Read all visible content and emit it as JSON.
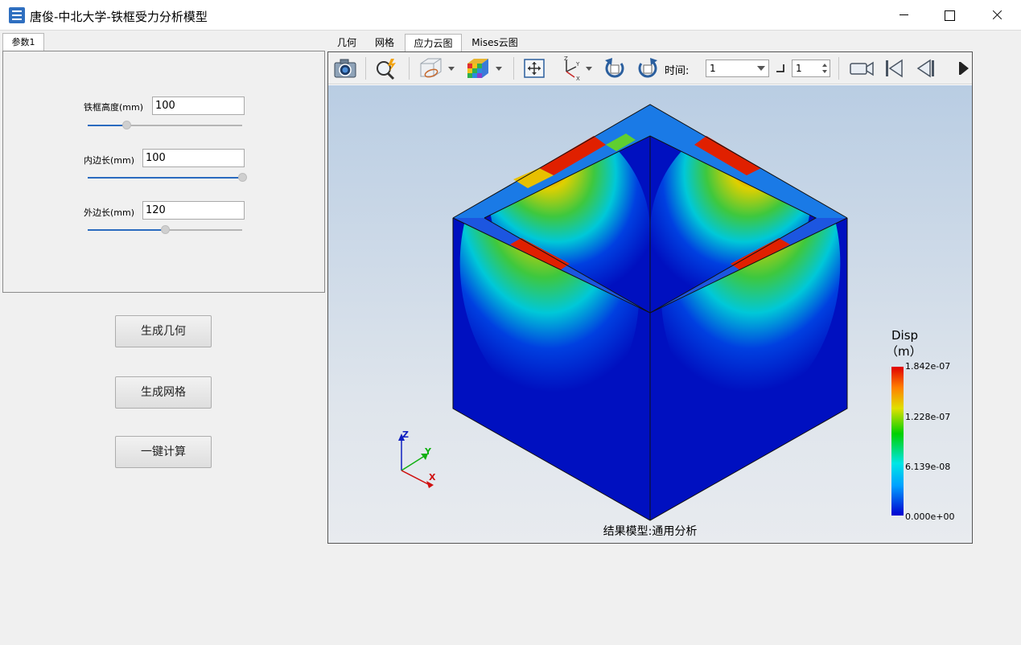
{
  "window": {
    "title": "唐俊-中北大学-铁框受力分析模型"
  },
  "left_panel": {
    "tab": "参数1",
    "params": [
      {
        "label": "铁框高度(mm)",
        "value": "100",
        "slider_fraction": 0.25
      },
      {
        "label": "内边长(mm)",
        "value": "100",
        "slider_fraction": 1.0
      },
      {
        "label": "外边长(mm)",
        "value": "120",
        "slider_fraction": 0.5
      }
    ]
  },
  "actions": {
    "generate_geometry": "生成几何",
    "generate_mesh": "生成网格",
    "compute": "一键计算"
  },
  "view_tabs": [
    "几何",
    "网格",
    "应力云图",
    "Mises云图"
  ],
  "active_view_tab": "应力云图",
  "toolbar": {
    "time_label": "时间:",
    "time_value": "1",
    "step_value": "1",
    "icons": [
      "camera-icon",
      "zoom-icon",
      "view-mode-icon",
      "color-cube-icon",
      "fit-view-icon",
      "axes-icon",
      "rotate-left-icon",
      "rotate-right-icon",
      "video-icon",
      "first-frame-icon",
      "prev-frame-icon",
      "next-frame-icon"
    ]
  },
  "viewer": {
    "caption": "结果模型:通用分析",
    "legend": {
      "title": "Disp",
      "unit": "（m）",
      "ticks": [
        "1.842e-07",
        "1.228e-07",
        "6.139e-08",
        "0.000e+00"
      ]
    },
    "axes": {
      "z": "Z",
      "y": "Y",
      "x": "X"
    }
  },
  "colors": {
    "accent": "#2a6bbf",
    "colormap_low": "#0000d0",
    "colormap_high": "#e00000"
  }
}
